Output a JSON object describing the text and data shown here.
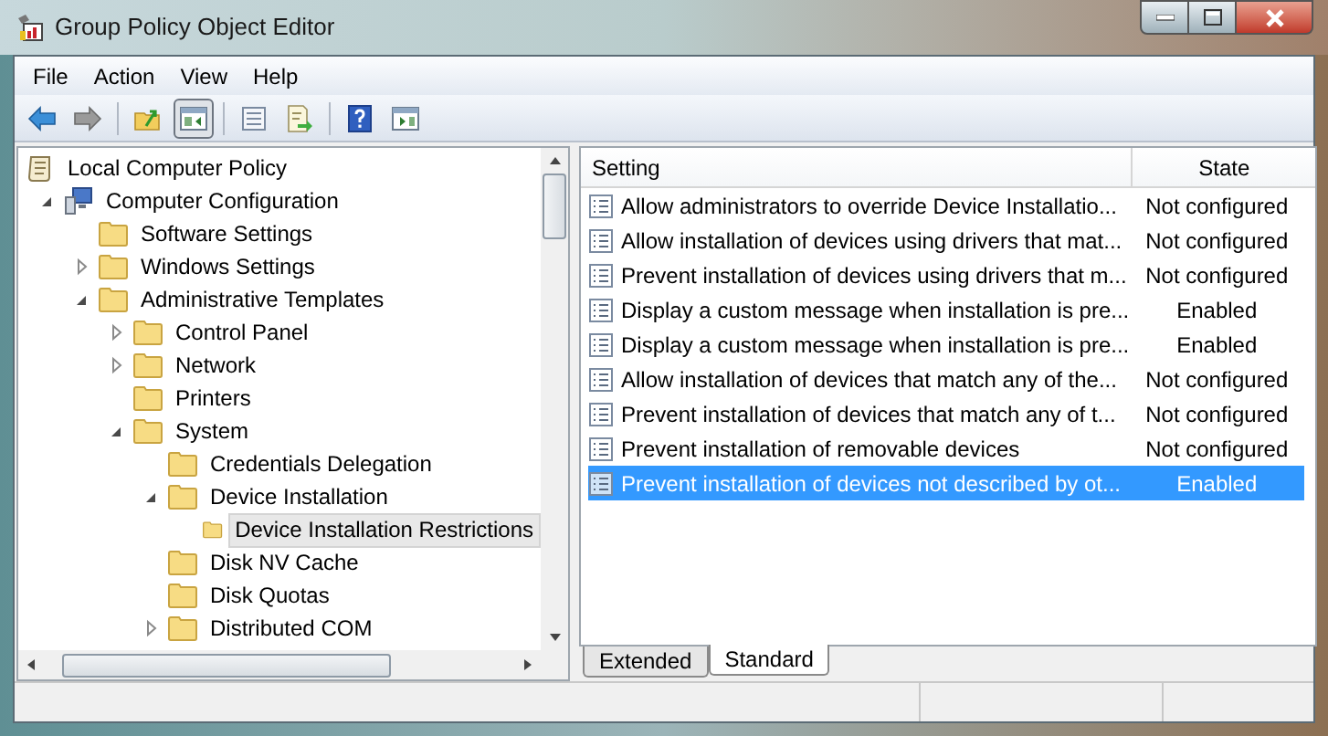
{
  "window": {
    "title": "Group Policy Object Editor"
  },
  "menu": [
    "File",
    "Action",
    "View",
    "Help"
  ],
  "toolbar": [
    {
      "kind": "back",
      "pressed": false
    },
    {
      "kind": "forward",
      "pressed": false
    },
    {
      "kind": "up",
      "pressed": false
    },
    {
      "kind": "tree",
      "pressed": true
    },
    {
      "kind": "properties",
      "pressed": false
    },
    {
      "kind": "export",
      "pressed": false
    },
    {
      "kind": "help",
      "pressed": false
    },
    {
      "kind": "pane",
      "pressed": false
    }
  ],
  "tree": [
    {
      "label": "Local Computer Policy",
      "kind": "policy",
      "selected": false,
      "children": [
        {
          "label": "Computer Configuration",
          "kind": "computer",
          "expanded": true,
          "selected": false,
          "children": [
            {
              "label": "Software Settings",
              "kind": "folder",
              "selected": false
            },
            {
              "label": "Windows Settings",
              "kind": "folder",
              "expanded": false,
              "selected": false
            },
            {
              "label": "Administrative Templates",
              "kind": "folder",
              "expanded": true,
              "selected": false,
              "children": [
                {
                  "label": "Control Panel",
                  "kind": "folder",
                  "expanded": false,
                  "selected": false
                },
                {
                  "label": "Network",
                  "kind": "folder",
                  "expanded": false,
                  "selected": false
                },
                {
                  "label": "Printers",
                  "kind": "folder",
                  "selected": false
                },
                {
                  "label": "System",
                  "kind": "folder",
                  "expanded": true,
                  "selected": false,
                  "children": [
                    {
                      "label": "Credentials Delegation",
                      "kind": "folder",
                      "selected": false
                    },
                    {
                      "label": "Device Installation",
                      "kind": "folder",
                      "expanded": true,
                      "selected": false,
                      "children": [
                        {
                          "label": "Device Installation Restrictions",
                          "kind": "folder",
                          "selected": true
                        }
                      ]
                    },
                    {
                      "label": "Disk NV Cache",
                      "kind": "folder",
                      "selected": false
                    },
                    {
                      "label": "Disk Quotas",
                      "kind": "folder",
                      "selected": false
                    },
                    {
                      "label": "Distributed COM",
                      "kind": "folder",
                      "expanded": false,
                      "selected": false
                    }
                  ]
                }
              ]
            }
          ]
        }
      ]
    }
  ],
  "table": {
    "columns": [
      "Setting",
      "State"
    ],
    "rows": [
      {
        "setting": "Allow administrators to override Device Installatio...",
        "state": "Not configured",
        "selected": false
      },
      {
        "setting": "Allow installation of devices using drivers that mat...",
        "state": "Not configured",
        "selected": false
      },
      {
        "setting": "Prevent installation of devices using drivers that m...",
        "state": "Not configured",
        "selected": false
      },
      {
        "setting": "Display a custom message when installation is pre...",
        "state": "Enabled",
        "selected": false
      },
      {
        "setting": "Display a custom message when installation is pre...",
        "state": "Enabled",
        "selected": false
      },
      {
        "setting": "Allow installation of devices that match any of the...",
        "state": "Not configured",
        "selected": false
      },
      {
        "setting": "Prevent installation of devices that match any of t...",
        "state": "Not configured",
        "selected": false
      },
      {
        "setting": "Prevent installation of removable devices",
        "state": "Not configured",
        "selected": false
      },
      {
        "setting": "Prevent installation of devices not described by ot...",
        "state": "Enabled",
        "selected": true
      }
    ]
  },
  "tabs": [
    {
      "label": "Extended",
      "selected": false
    },
    {
      "label": "Standard",
      "selected": true
    }
  ]
}
